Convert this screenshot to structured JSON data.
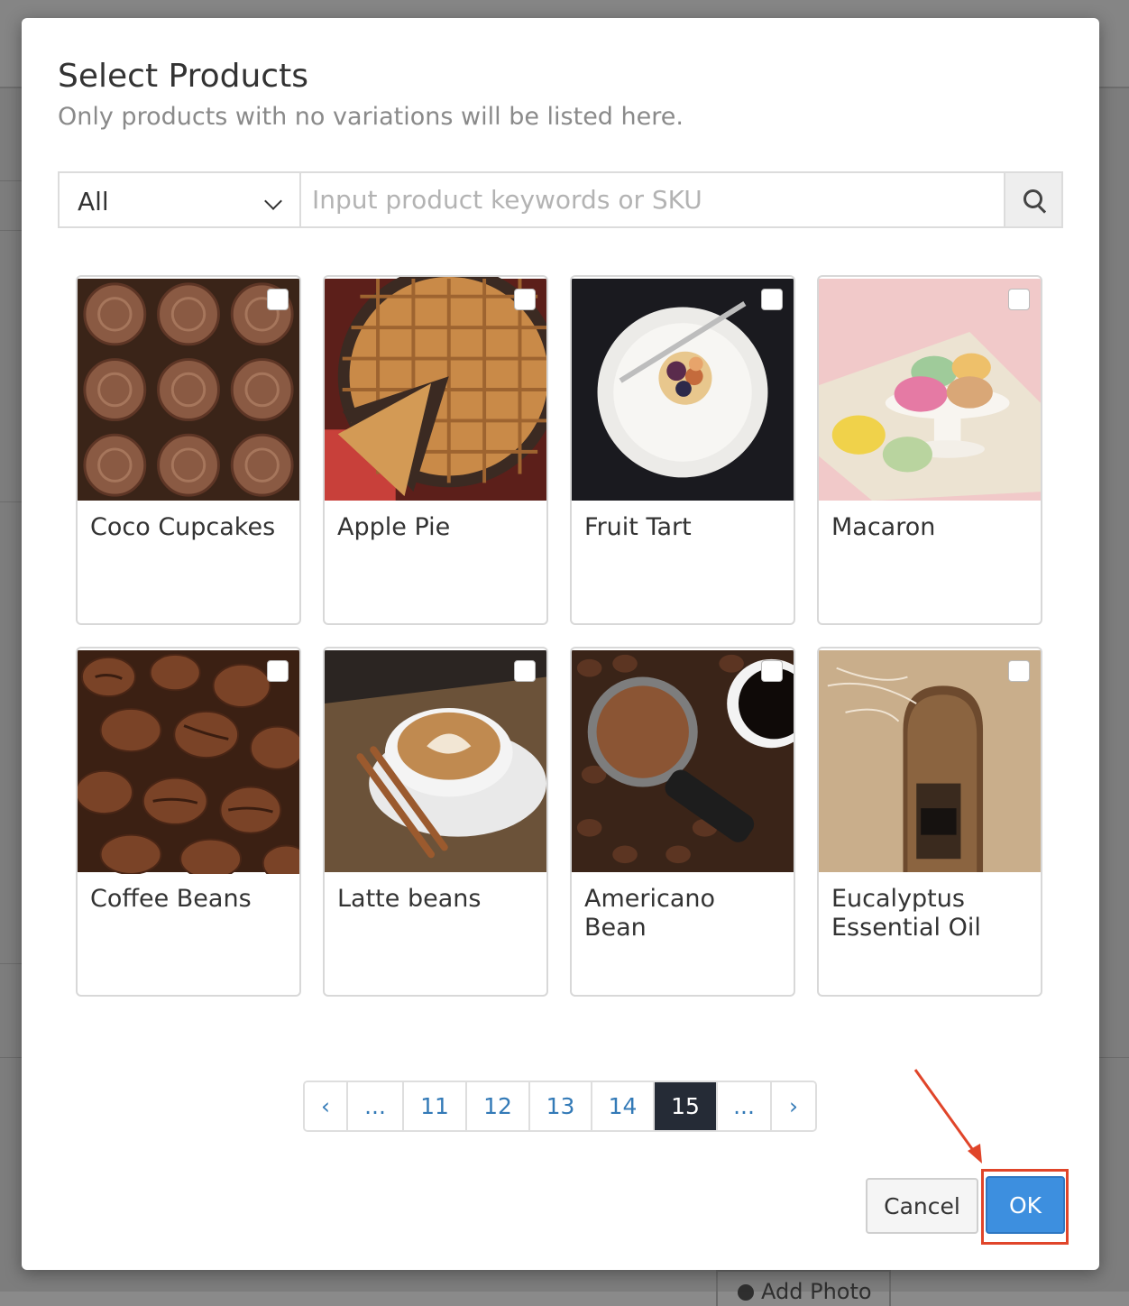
{
  "modal": {
    "title": "Select Products",
    "subtitle": "Only products with no variations will be listed here."
  },
  "search": {
    "category_value": "All",
    "placeholder": "Input product keywords or SKU",
    "icon": "search-icon"
  },
  "products": [
    {
      "name": "Coco Cupcakes",
      "selected": false
    },
    {
      "name": "Apple Pie",
      "selected": false
    },
    {
      "name": "Fruit Tart",
      "selected": false
    },
    {
      "name": "Macaron",
      "selected": false
    },
    {
      "name": "Coffee Beans",
      "selected": false
    },
    {
      "name": "Latte beans",
      "selected": false
    },
    {
      "name": "Americano Bean",
      "selected": false
    },
    {
      "name": "Eucalyptus Essential Oil",
      "selected": false
    }
  ],
  "pagination": {
    "prev": "‹",
    "items": [
      "...",
      "11",
      "12",
      "13",
      "14",
      "15",
      "..."
    ],
    "active": "15",
    "next": "›"
  },
  "footer": {
    "cancel_label": "Cancel",
    "ok_label": "OK"
  },
  "colors": {
    "primary": "#3d8fdf",
    "link": "#337ab7",
    "active_page": "#252b36",
    "highlight": "#e0452a"
  },
  "background": {
    "add_photo_label": "Add Photo"
  }
}
